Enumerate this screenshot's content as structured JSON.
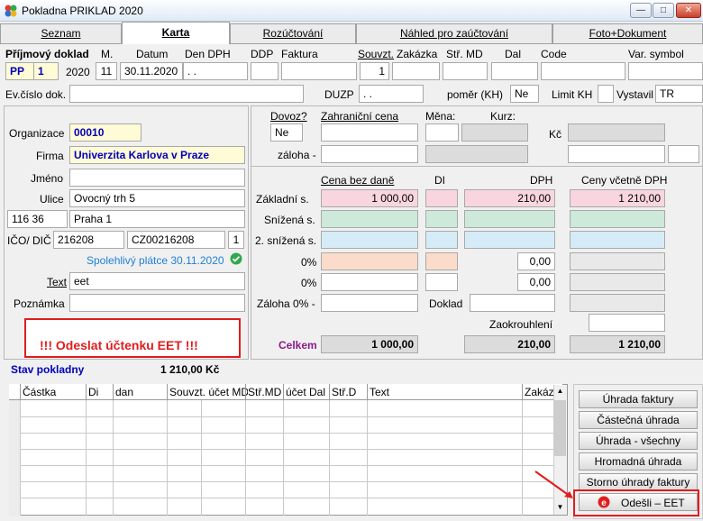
{
  "window": {
    "title": "Pokladna PRIKLAD  2020"
  },
  "tabs": [
    "Seznam",
    "Karta",
    "Rozúčtování",
    "Náhled pro zaúčtování",
    "Foto+Dokument"
  ],
  "header": {
    "doc_label": "Příjmový doklad",
    "col_m": "M.",
    "col_datum": "Datum",
    "col_den_dph": "Den DPH",
    "col_ddp": "DDP",
    "col_faktura": "Faktura",
    "col_souvzt": "Souvzt.",
    "col_zakazka": "Zakázka",
    "col_str_md": "Stř. MD",
    "col_dal": "Dal",
    "col_code": "Code",
    "col_var": "Var. symbol",
    "doc_type": "PP",
    "doc_no": "1",
    "year": "2020",
    "month": "11",
    "date": "30.11.2020",
    "den_dph": ". .",
    "souvzt": "1",
    "ev_label": "Ev.číslo dok.",
    "duzp_label": "DUZP",
    "duzp": ". .",
    "pomer_label": "poměr (KH)",
    "pomer": "Ne",
    "limit_label": "Limit KH",
    "vystavil_label": "Vystavil",
    "vystavil": "TR"
  },
  "party": {
    "org_label": "Organizace",
    "org": "00010",
    "firma_label": "Firma",
    "firma": "Univerzita Karlova v Praze",
    "jmeno_label": "Jméno",
    "ulice_label": "Ulice",
    "ulice": "Ovocný trh 5",
    "psc": "116 36",
    "mesto": "Praha 1",
    "ico_label": "IČO/ DIČ",
    "ico": "216208",
    "dic": "CZ00216208",
    "ico_extra": "1",
    "spolehlivy": "Spolehlivý plátce 30.11.2020",
    "text_label": "Text",
    "text": "eet",
    "poznamka_label": "Poznámka"
  },
  "eet_notice": "!!! Odeslat účtenku EET !!!",
  "foreign": {
    "dovoz_label": "Dovoz?",
    "dovoz": "Ne",
    "zahr_label": "Zahraniční cena",
    "mena_label": "Měna:",
    "kurz_label": "Kurz:",
    "kc_label": "Kč",
    "zaloha_label": "záloha -"
  },
  "vat": {
    "h_bez": "Cena bez daně",
    "h_di": "DI",
    "h_dph": "DPH",
    "h_vc": "Ceny včetně DPH",
    "zakladni_label": "Základní s.",
    "zakladni_bez": "1 000,00",
    "zakladni_dph": "210,00",
    "zakladni_vc": "1 210,00",
    "snizena_label": "Snížená s.",
    "snizena2_label": "2. snížená s.",
    "zero1_label": "0%",
    "zero1_dph": "0,00",
    "zero2_label": "0%",
    "zero2_dph": "0,00",
    "zaloha0_label": "Záloha 0% -",
    "doklad_label": "Doklad",
    "zaokrouhleni_label": "Zaokrouhlení",
    "celkem_label": "Celkem",
    "celkem_bez": "1 000,00",
    "celkem_dph": "210,00",
    "celkem_vc": "1 210,00"
  },
  "stav": {
    "label": "Stav pokladny",
    "value": "1 210,00 Kč"
  },
  "grid": {
    "columns": [
      "Částka",
      "Di",
      "dan",
      "Souvzt. účet MD",
      "Stř.MD",
      "účet Dal",
      "Stř.D",
      "Text",
      "Zakáz"
    ]
  },
  "actions": [
    "Úhrada faktury",
    "Částečná úhrada",
    "Úhrada - všechny",
    "Hromadná úhrada",
    "Storno úhrady faktury"
  ],
  "eet_button": "Odešli – EET",
  "colors": {
    "accent_red": "#e11c1c",
    "link_blue": "#0000b8",
    "yellow_field": "#fffbd6"
  }
}
